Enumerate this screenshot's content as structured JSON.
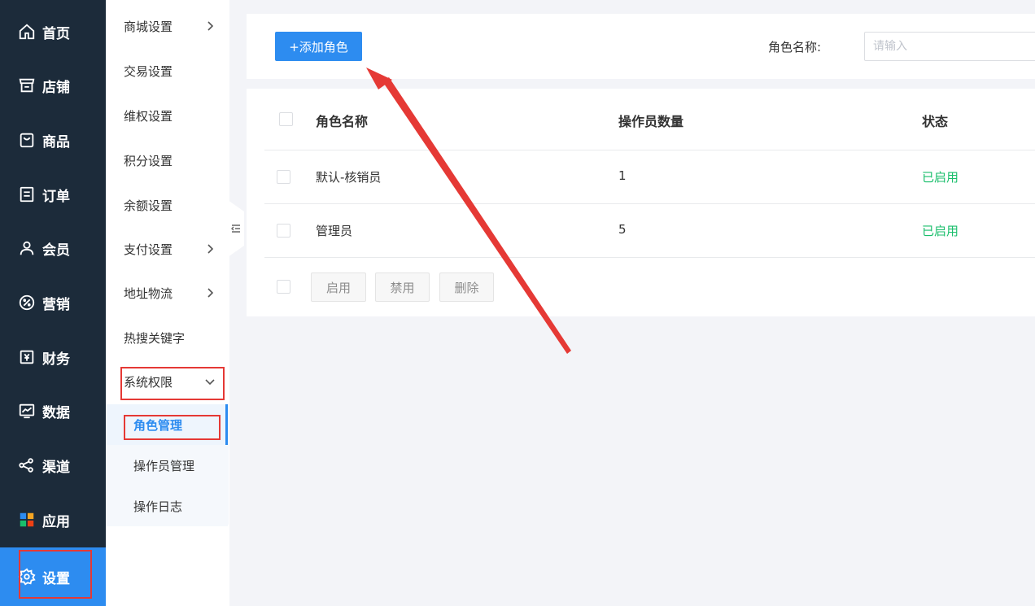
{
  "nav_primary": [
    {
      "label": "首页",
      "icon": "home-icon"
    },
    {
      "label": "店铺",
      "icon": "store-icon"
    },
    {
      "label": "商品",
      "icon": "bag-icon"
    },
    {
      "label": "订单",
      "icon": "order-icon"
    },
    {
      "label": "会员",
      "icon": "user-icon"
    },
    {
      "label": "营销",
      "icon": "percent-icon"
    },
    {
      "label": "财务",
      "icon": "yen-icon"
    },
    {
      "label": "数据",
      "icon": "chart-icon"
    },
    {
      "label": "渠道",
      "icon": "share-icon"
    },
    {
      "label": "应用",
      "icon": "apps-icon"
    },
    {
      "label": "设置",
      "icon": "gear-icon"
    }
  ],
  "nav_secondary": [
    {
      "label": "商城设置"
    },
    {
      "label": "交易设置"
    },
    {
      "label": "维权设置"
    },
    {
      "label": "积分设置"
    },
    {
      "label": "余额设置"
    },
    {
      "label": "支付设置"
    },
    {
      "label": "地址物流"
    },
    {
      "label": "热搜关键字"
    },
    {
      "label": "系统权限"
    }
  ],
  "nav_sub": [
    {
      "label": "角色管理"
    },
    {
      "label": "操作员管理"
    },
    {
      "label": "操作日志"
    }
  ],
  "toolbar": {
    "add_label": "+添加角色",
    "search_label": "角色名称:",
    "search_placeholder": "请输入"
  },
  "table": {
    "headers": [
      "角色名称",
      "操作员数量",
      "状态"
    ],
    "rows": [
      {
        "name": "默认-核销员",
        "count": "1",
        "status": "已启用"
      },
      {
        "name": "管理员",
        "count": "5",
        "status": "已启用"
      }
    ],
    "bulk_actions": [
      "启用",
      "禁用",
      "删除"
    ]
  },
  "colors": {
    "nav_bg": "#1c2b3a",
    "accent": "#2d8cf0",
    "status_enabled": "#19be6b",
    "annotation": "#e53935"
  }
}
